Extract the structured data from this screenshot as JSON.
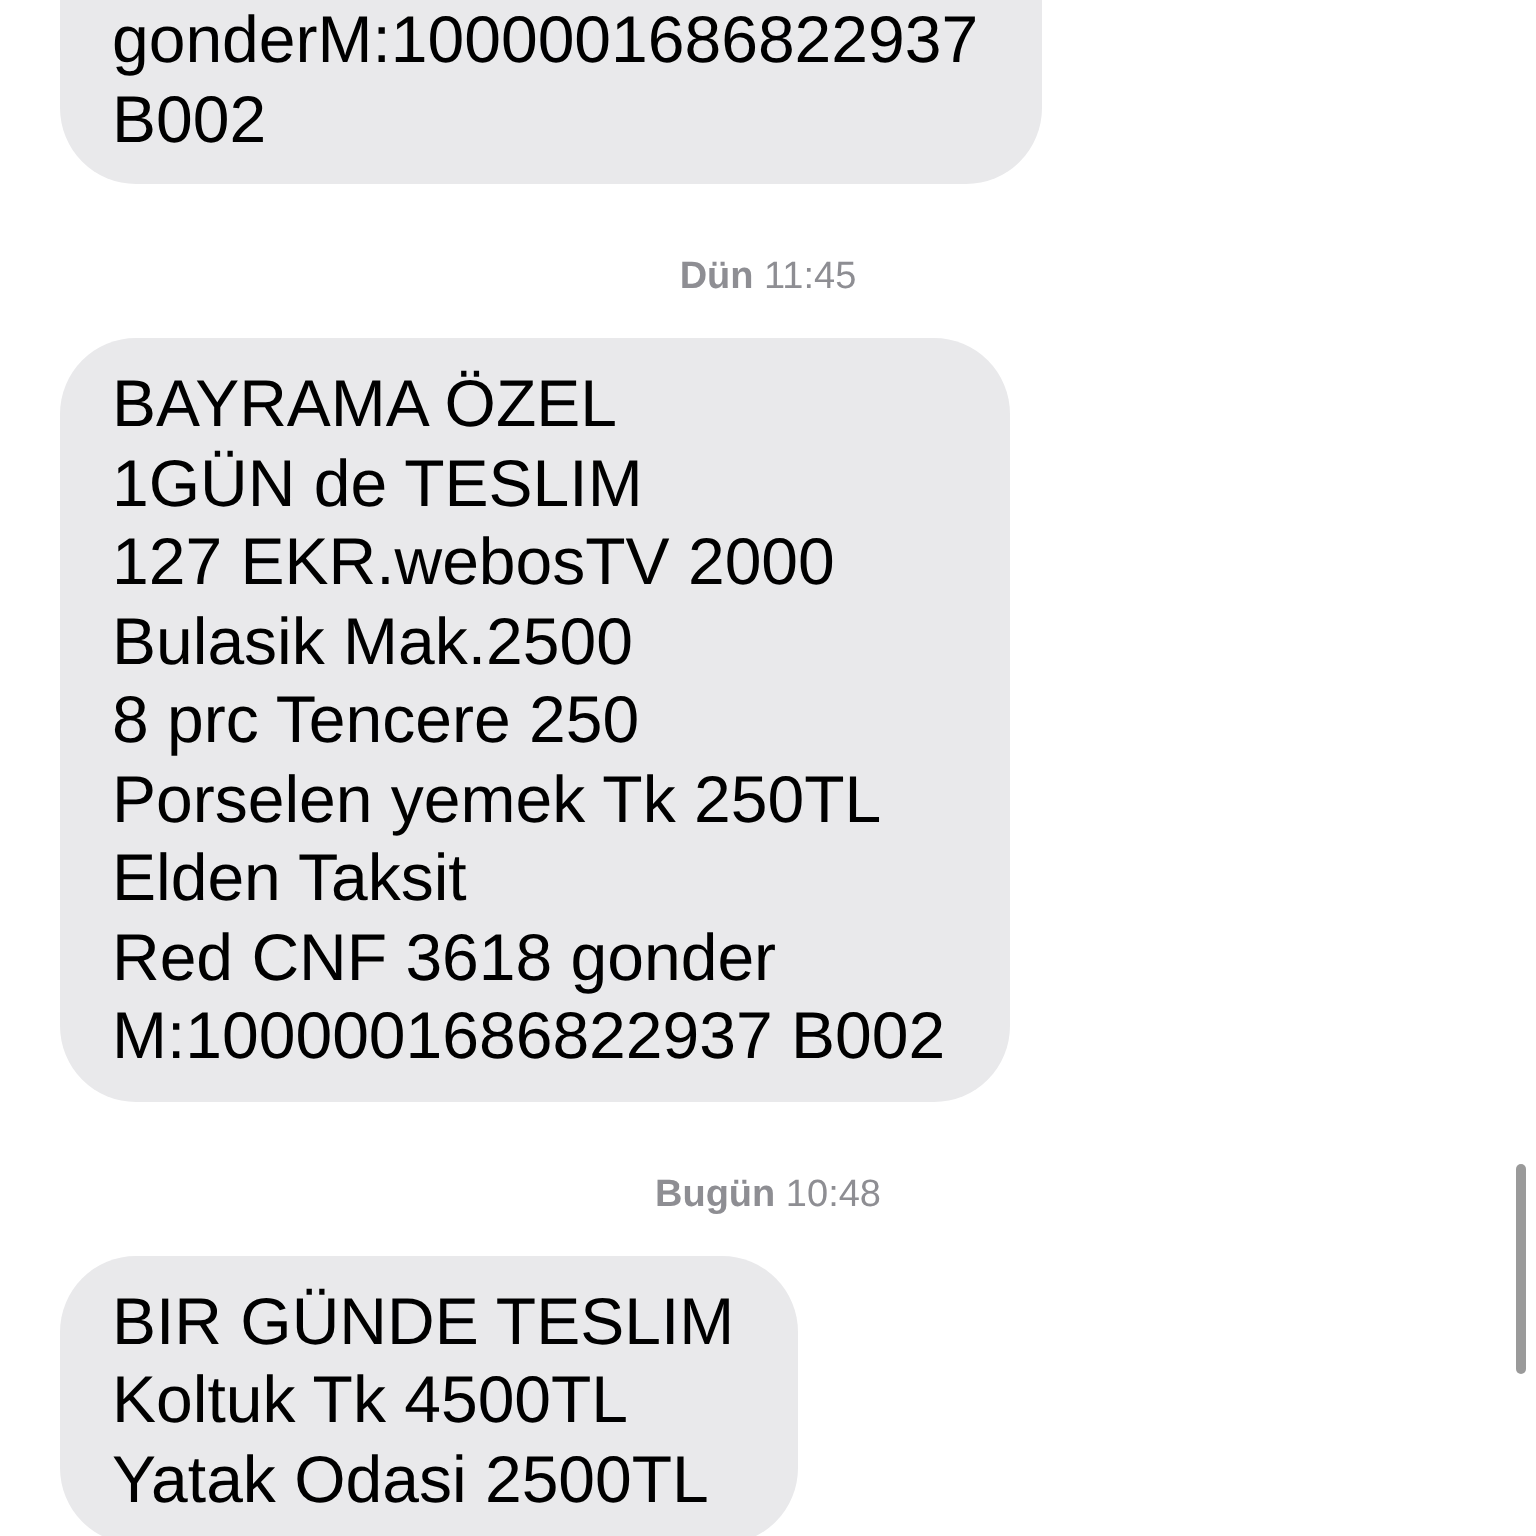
{
  "thread": [
    {
      "kind": "message",
      "lines": [
        "gonderM:1000001686822937",
        "B002"
      ]
    },
    {
      "kind": "timestamp",
      "text": "**Dün** 11:45"
    },
    {
      "kind": "message",
      "lines": [
        "BAYRAMA ÖZEL",
        "1GÜN de TESLIM",
        "127 EKR.webosTV 2000",
        "Bulasik Mak.2500",
        "8 prc Tencere 250",
        "Porselen yemek Tk 250TL",
        "Elden Taksit",
        "Red CNF 3618 gonder",
        "M:1000001686822937 B002"
      ]
    },
    {
      "kind": "timestamp",
      "text": "**Bugün** 10:48"
    },
    {
      "kind": "message",
      "lines": [
        "BIR GÜNDE TESLIM",
        "Koltuk Tk 4500TL",
        "Yatak Odasi 2500TL"
      ]
    }
  ]
}
